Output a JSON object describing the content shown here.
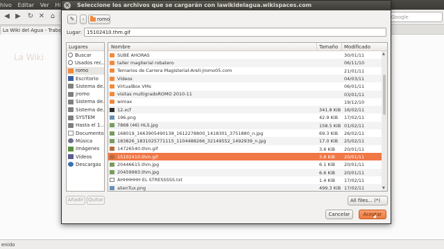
{
  "browser": {
    "menu": [
      "hivo",
      "Editar",
      "Ver",
      "Historia"
    ],
    "tab_title": "La Wiki del Agua - Trabajos",
    "search_placeholder": "Google",
    "status": "enido",
    "logo_text": "La Wiki"
  },
  "dialog": {
    "title": "Seleccione los archivos que se cargarán con lawikidelagua.wikispaces.com",
    "path_button": "romo",
    "location_label": "Lugar:",
    "location_value": "15102410.thm.gif",
    "places_header": "Lugares",
    "places": [
      {
        "label": "Buscar",
        "icon": "search-icon"
      },
      {
        "label": "Usados rec...",
        "icon": "clock-icon"
      },
      {
        "label": "romo",
        "icon": "home-folder-icon",
        "selected": true
      },
      {
        "label": "Escritorio",
        "icon": "desktop-icon"
      },
      {
        "label": "Sistema de...",
        "icon": "drive-icon"
      },
      {
        "label": "jromo",
        "icon": "drive-icon"
      },
      {
        "label": "Sistema de...",
        "icon": "drive-icon"
      },
      {
        "label": "Sistema de...",
        "icon": "drive-icon"
      },
      {
        "label": "SYSTEM",
        "icon": "drive-icon"
      },
      {
        "label": "Hasta el 1...",
        "icon": "drive-icon"
      },
      {
        "label": "Documentos",
        "icon": "documents-icon"
      },
      {
        "label": "Música",
        "icon": "music-icon"
      },
      {
        "label": "Imágenes",
        "icon": "pictures-icon"
      },
      {
        "label": "Vídeos",
        "icon": "videos-icon"
      },
      {
        "label": "Descargas",
        "icon": "downloads-icon"
      }
    ],
    "add_label": "Añadir",
    "remove_label": "Quitar",
    "columns": {
      "name": "Nombre",
      "size": "Tamaño",
      "modified": "Modificado"
    },
    "files": [
      {
        "name": "SUBE AHORAS",
        "size": "",
        "modified": "30/01/11",
        "type": "folder"
      },
      {
        "name": "taller magiterial robatero",
        "size": "",
        "modified": "06/11/10",
        "type": "folder"
      },
      {
        "name": "Temarios de Carrera Magisterial-Areli-jromo05.com",
        "size": "",
        "modified": "21/01/11",
        "type": "folder"
      },
      {
        "name": "Vídeos",
        "size": "",
        "modified": "04/03/11",
        "type": "folder"
      },
      {
        "name": "VirtualBox VMs",
        "size": "",
        "modified": "06/01/11",
        "type": "folder"
      },
      {
        "name": "visitas multigradoROMO 2010-11",
        "size": "",
        "modified": "03/01/11",
        "type": "folder"
      },
      {
        "name": "wimax",
        "size": "",
        "modified": "19/12/10",
        "type": "folder"
      },
      {
        "name": "12.xcf",
        "size": "341.8 KiB",
        "modified": "16/02/11",
        "type": "file"
      },
      {
        "name": "196.png",
        "size": "42.9 KiB",
        "modified": "17/02/11",
        "type": "img"
      },
      {
        "name": "7868 (46) HLS.jpg",
        "size": "158.5 KiB",
        "modified": "01/02/11",
        "type": "jpg"
      },
      {
        "name": "168019_1663905490138_1612278800_1418301_3751880_n.jpg",
        "size": "69.3 KiB",
        "modified": "26/02/11",
        "type": "jpg"
      },
      {
        "name": "183826_1831025771115_1104488266_32149552_1492939_n.jpg",
        "size": "17.0 KiB",
        "modified": "25/02/11",
        "type": "jpg"
      },
      {
        "name": "14726540.thm.gif",
        "size": "3.6 KiB",
        "modified": "20/01/11",
        "type": "gif"
      },
      {
        "name": "15102410.thm.gif",
        "size": "3.8 KiB",
        "modified": "20/01/11",
        "type": "gif",
        "selected": true
      },
      {
        "name": "20446615.thm.jpg",
        "size": "6.1 KiB",
        "modified": "20/01/11",
        "type": "jpg"
      },
      {
        "name": "20459983.thm.jpg",
        "size": "6.6 KiB",
        "modified": "20/01/11",
        "type": "jpg"
      },
      {
        "name": "AHHHHHH EL STRESSSSS.txt",
        "size": "1.4 KiB",
        "modified": "17/02/11",
        "type": "txt"
      },
      {
        "name": "alienTux.png",
        "size": "499.3 KiB",
        "modified": "17/02/11",
        "type": "img"
      }
    ],
    "filter_label": "All files... (*)",
    "cancel_label": "Cancelar",
    "accept_label": "Aceptar"
  },
  "colors": {
    "accent": "#f07746",
    "titlebar": "#3c3b37"
  }
}
